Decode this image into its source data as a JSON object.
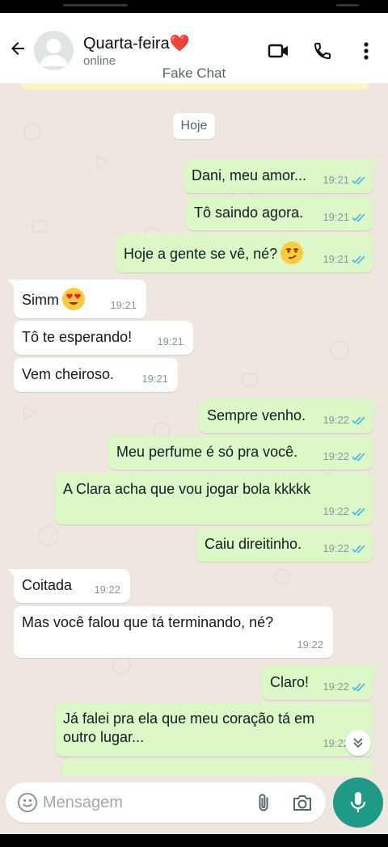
{
  "header": {
    "contact_name": "Quarta-feira❤️",
    "status": "online",
    "watermark": "Fake Chat",
    "icons": [
      "back-arrow-icon",
      "avatar-placeholder-icon",
      "video-call-icon",
      "phone-call-icon",
      "more-vertical-icon"
    ]
  },
  "chat": {
    "date_label": "Hoje",
    "messages": [
      {
        "direction": "out",
        "text": "Dani, meu amor...",
        "time": "19:21",
        "status": "read"
      },
      {
        "direction": "out",
        "text": "Tô saindo agora.",
        "time": "19:21",
        "status": "read"
      },
      {
        "direction": "out",
        "text": "Hoje a gente se vê, né?",
        "emoji": "smirking-face",
        "time": "19:21",
        "status": "read"
      },
      {
        "direction": "in",
        "text": "Simm",
        "emoji": "heart-eyes-face",
        "time": "19:21"
      },
      {
        "direction": "in",
        "text": "Tô te esperando!",
        "time": "19:21"
      },
      {
        "direction": "in",
        "text": "Vem cheiroso.",
        "time": "19:21"
      },
      {
        "direction": "out",
        "text": "Sempre venho.",
        "time": "19:22",
        "status": "read"
      },
      {
        "direction": "out",
        "text": "Meu perfume é só pra você.",
        "time": "19:22",
        "status": "read"
      },
      {
        "direction": "out",
        "text": "A Clara acha que vou jogar bola kkkkk",
        "time": "19:22",
        "status": "read"
      },
      {
        "direction": "out",
        "text": "Caiu direitinho.",
        "time": "19:22",
        "status": "read"
      },
      {
        "direction": "in",
        "text": "Coitada",
        "time": "19:22"
      },
      {
        "direction": "in",
        "text": "Mas você falou que tá terminando, né?",
        "time": "19:22"
      },
      {
        "direction": "out",
        "text": "Claro!",
        "time": "19:22",
        "status": "read"
      },
      {
        "direction": "out",
        "text": "Já falei pra ela que meu coração tá em outro lugar...",
        "time": "19:22",
        "status": "read"
      }
    ]
  },
  "composer": {
    "placeholder": "Mensagem",
    "icons": [
      "emoji-icon",
      "attach-icon",
      "camera-icon",
      "mic-icon"
    ]
  },
  "colors": {
    "outgoing_bubble": "#dcf8c6",
    "incoming_bubble": "#ffffff",
    "chat_background": "#efe7df",
    "read_ticks": "#34b7f1",
    "mic_button": "#1f9a87"
  }
}
